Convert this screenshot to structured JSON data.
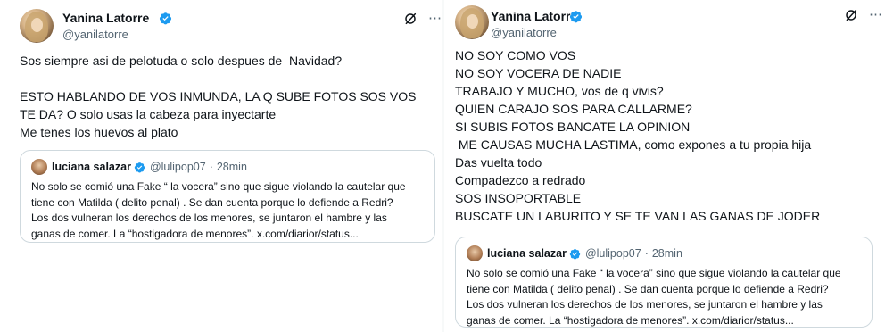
{
  "colors": {
    "verified": "#1d9bf0",
    "secondary_text": "#536471",
    "card_border": "#cfd9de"
  },
  "tweets": [
    {
      "author": {
        "name": "Yanina Latorre",
        "handle": "@yanilatorre",
        "verified": true,
        "avatar_icon": "profile-photo"
      },
      "icons": {
        "grok": "grok-icon",
        "more": "⋯"
      },
      "text": "Sos siempre asi de pelotuda o solo despues de  Navidad?\n\nESTO HABLANDO DE VOS INMUNDA, LA Q SUBE FOTOS SOS VOS\nTE DA? O solo usas la cabeza para inyectarte\nMe tenes los huevos al plato",
      "quote": {
        "author": {
          "name": "luciana salazar",
          "handle": "@lulipop07",
          "verified": true
        },
        "separator": "·",
        "time": "28min",
        "text": "No solo se comió una Fake “ la vocera” sino que sigue violando la cautelar que\ntiene con Matilda ( delito penal) . Se dan cuenta porque lo defiende a Redri?\nLos dos vulneran los derechos de los menores, se juntaron el hambre y las\nganas de comer. La “hostigadora de menores”. x.com/diarior/status..."
      }
    },
    {
      "author": {
        "name": "Yanina Latorre",
        "handle": "@yanilatorre",
        "verified": true,
        "avatar_icon": "profile-photo"
      },
      "icons": {
        "grok": "grok-icon",
        "more": "⋯"
      },
      "text": "NO SOY COMO VOS\nNO SOY VOCERA DE NADIE\nTRABAJO Y MUCHO, vos de q vivis?\nQUIEN CARAJO SOS PARA CALLARME?\nSI SUBIS FOTOS BANCATE LA OPINION\n ME CAUSAS MUCHA LASTIMA, como expones a tu propia hija\nDas vuelta todo\nCompadezco a redrado\nSOS INSOPORTABLE\nBUSCATE UN LABURITO Y SE TE VAN LAS GANAS DE JODER",
      "quote": {
        "author": {
          "name": "luciana salazar",
          "handle": "@lulipop07",
          "verified": true
        },
        "separator": "·",
        "time": "28min",
        "text": "No solo se comió una Fake “ la vocera” sino que sigue violando la cautelar que\ntiene con Matilda ( delito penal) . Se dan cuenta porque lo defiende a Redri?\nLos dos vulneran los derechos de los menores, se juntaron el hambre y las\nganas de comer. La “hostigadora de menores”. x.com/diarior/status..."
      }
    }
  ]
}
